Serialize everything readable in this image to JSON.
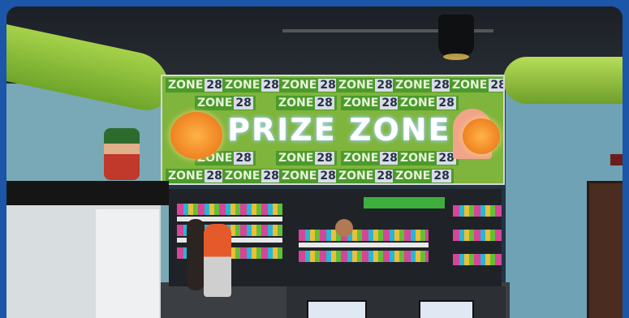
{
  "image": {
    "screen": {
      "title": "PRIZE ZONE",
      "tiles": [
        {
          "word": "ZONE",
          "number": "28"
        }
      ]
    }
  }
}
